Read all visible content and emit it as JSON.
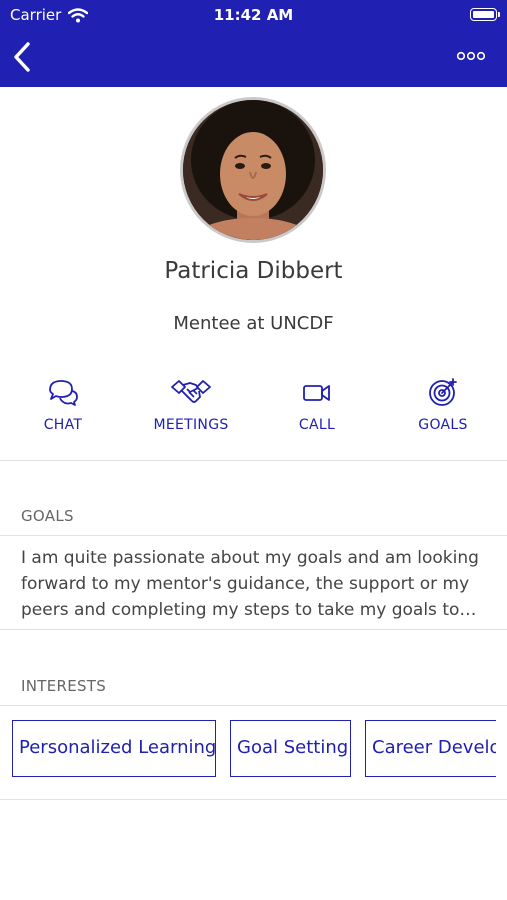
{
  "status_bar": {
    "carrier": "Carrier",
    "time": "11:42 AM"
  },
  "nav": {
    "back_icon": "chevron-left-icon",
    "more_icon": "ellipsis-icon"
  },
  "profile": {
    "name": "Patricia Dibbert",
    "role": "Mentee at UNCDF"
  },
  "actions": [
    {
      "label": "CHAT",
      "icon": "chat-bubbles-icon"
    },
    {
      "label": "MEETINGS",
      "icon": "handshake-icon"
    },
    {
      "label": "CALL",
      "icon": "video-camera-icon"
    },
    {
      "label": "GOALS",
      "icon": "target-icon"
    }
  ],
  "goals": {
    "title": "GOALS",
    "text": "I am quite passionate about my goals and am looking forward to my mentor's guidance, the support or my peers and completing my steps to take my goals to…"
  },
  "interests": {
    "title": "INTERESTS",
    "items": [
      "Personalized Learning",
      "Goal Setting",
      "Career Develo"
    ]
  },
  "colors": {
    "brand": "#2020b2",
    "text": "#3a3a3a",
    "divider": "#e1e1e1"
  }
}
